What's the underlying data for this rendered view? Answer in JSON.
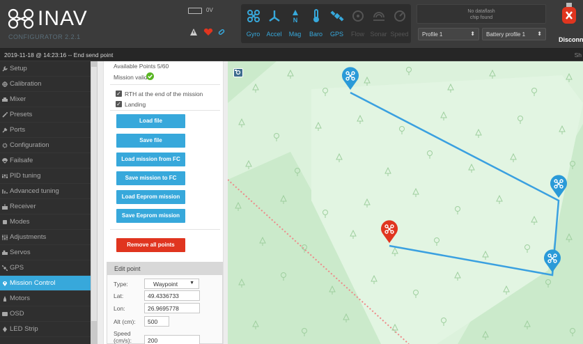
{
  "header": {
    "logo_text": "INAV",
    "logo_sub": "CONFIGURATOR  2.2.1",
    "battery_voltage": "0V",
    "sensors": [
      {
        "label": "Gyro",
        "icon": "gyro-icon",
        "active": true
      },
      {
        "label": "Accel",
        "icon": "accel-icon",
        "active": true
      },
      {
        "label": "Mag",
        "icon": "mag-icon",
        "active": true
      },
      {
        "label": "Baro",
        "icon": "baro-icon",
        "active": true
      },
      {
        "label": "GPS",
        "icon": "gps-icon",
        "active": true
      },
      {
        "label": "Flow",
        "icon": "flow-icon",
        "active": false
      },
      {
        "label": "Sonar",
        "icon": "sonar-icon",
        "active": false
      },
      {
        "label": "Speed",
        "icon": "speed-icon",
        "active": false
      }
    ],
    "dataflash_line1": "No dataflash",
    "dataflash_line2": "chip found",
    "profile_select": "Profile 1",
    "battery_profile_select": "Battery profile 1",
    "disconnect_label": "Disconne",
    "colors": {
      "active_sensor": "#37a8db",
      "inactive_sensor": "#555555",
      "accent": "#37a8db",
      "disconnect": "#e0351f"
    }
  },
  "status_bar": {
    "log": "2019-11-18 @ 14:23:16 -- End send point",
    "right_text": "Sh"
  },
  "sidebar": {
    "items": [
      {
        "label": "Setup",
        "icon": "wrench-icon"
      },
      {
        "label": "Calibration",
        "icon": "crosshair-icon"
      },
      {
        "label": "Mixer",
        "icon": "mixer-icon"
      },
      {
        "label": "Presets",
        "icon": "wand-icon"
      },
      {
        "label": "Ports",
        "icon": "plug-icon"
      },
      {
        "label": "Configuration",
        "icon": "gear-icon"
      },
      {
        "label": "Failsafe",
        "icon": "parachute-icon"
      },
      {
        "label": "PID tuning",
        "icon": "sliders-icon"
      },
      {
        "label": "Advanced tuning",
        "icon": "advanced-icon"
      },
      {
        "label": "Receiver",
        "icon": "receiver-icon"
      },
      {
        "label": "Modes",
        "icon": "modes-icon"
      },
      {
        "label": "Adjustments",
        "icon": "adjustments-icon"
      },
      {
        "label": "Servos",
        "icon": "servo-icon"
      },
      {
        "label": "GPS",
        "icon": "satellite-icon"
      },
      {
        "label": "Mission Control",
        "icon": "map-pin-icon",
        "active": true
      },
      {
        "label": "Motors",
        "icon": "motor-icon"
      },
      {
        "label": "OSD",
        "icon": "osd-icon"
      },
      {
        "label": "LED Strip",
        "icon": "led-icon"
      }
    ]
  },
  "mission_panel": {
    "available_points": "Available Points 5/60",
    "mission_valid": "Mission valid",
    "rth_label": "RTH at the end of the mission",
    "rth_checked": true,
    "landing_label": "Landing",
    "landing_checked": true,
    "buttons": {
      "load_file": "Load file",
      "save_file": "Save file",
      "load_from_fc": "Load mission from FC",
      "save_to_fc": "Save mission to FC",
      "load_eeprom": "Load Eeprom mission",
      "save_eeprom": "Save Eeprom mission",
      "remove_all": "Remove all points"
    }
  },
  "edit_point": {
    "title": "Edit point",
    "type_label": "Type:",
    "type_value": "Waypoint",
    "lat_label": "Lat:",
    "lat_value": "49.4336733",
    "lon_label": "Lon:",
    "lon_value": "26.9695778",
    "alt_label": "Alt (cm):",
    "alt_value": "500",
    "speed_label_1": "Speed",
    "speed_label_2": "(cm/s):",
    "speed_value": "200"
  },
  "map": {
    "route_color": "#3aa0e0",
    "selected_marker_color": "#e0351f",
    "marker_color": "#2a9ad8"
  }
}
